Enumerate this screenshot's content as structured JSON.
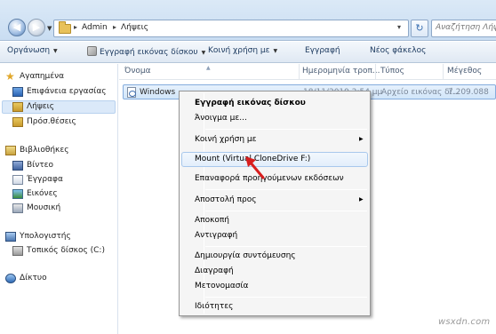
{
  "address": {
    "path": [
      "Admin",
      "Λήψεις"
    ],
    "search_placeholder": "Αναζήτηση Λήψεις",
    "back_glyph": "◀",
    "forward_glyph": "▶",
    "refresh_glyph": "↻"
  },
  "toolbar": {
    "organize": "Οργάνωση",
    "burn_image": "Εγγραφή εικόνας δίσκου",
    "share_with": "Κοινή χρήση με",
    "burn": "Εγγραφή",
    "new_folder": "Νέος φάκελος"
  },
  "sidebar": {
    "favorites": "Αγαπημένα",
    "desktop": "Επιφάνεια εργασίας",
    "downloads": "Λήψεις",
    "recent": "Πρόσ.θέσεις",
    "libraries": "Βιβλιοθήκες",
    "videos": "Βίντεο",
    "documents": "Έγγραφα",
    "pictures": "Εικόνες",
    "music": "Μουσική",
    "computer": "Υπολογιστής",
    "local_disk": "Τοπικός δίσκος (C:)",
    "network": "Δίκτυο"
  },
  "columns": {
    "name": "Όνομα",
    "date": "Ημερομηνία τροπ...",
    "type": "Τύπος",
    "size": "Μέγεθος"
  },
  "file": {
    "name": "Windows",
    "date": "18/11/2019 2:54 μμ",
    "type": "Αρχείο εικόνας δί...",
    "size": "7.209.088"
  },
  "context_menu": {
    "burn_image": "Εγγραφή εικόνας δίσκου",
    "open_with": "Άνοιγμα με...",
    "share_with": "Κοινή χρήση με",
    "mount": "Mount (Virtual CloneDrive F:)",
    "restore_previous": "Επαναφορά προηγούμενων εκδόσεων",
    "send_to": "Αποστολή προς",
    "cut": "Αποκοπή",
    "copy": "Αντιγραφή",
    "create_shortcut": "Δημιουργία συντόμευσης",
    "delete": "Διαγραφή",
    "rename": "Μετονομασία",
    "properties": "Ιδιότητες"
  },
  "watermark": "wsxdn.com",
  "colors": {
    "selection": "#d2e6fa",
    "arrow": "#d81e1e"
  }
}
